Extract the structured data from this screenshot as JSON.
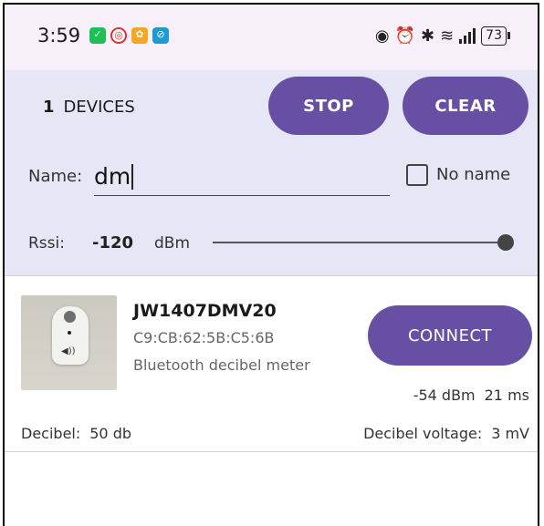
{
  "status_bar": {
    "time": "3:59",
    "notification_icons": [
      "wechat-icon",
      "app-icon",
      "meituan-icon",
      "link-icon"
    ],
    "battery": "73"
  },
  "panel": {
    "device_count": "1",
    "device_count_label": "DEVICES",
    "stop_label": "STOP",
    "clear_label": "CLEAR",
    "name_label": "Name:",
    "name_value": "dm",
    "no_name_label": "No name",
    "no_name_checked": false,
    "rssi_label": "Rssi:",
    "rssi_value": "-120",
    "rssi_unit": "dBm",
    "rssi_slider_fraction": 1.0
  },
  "devices": [
    {
      "name": "JW1407DMV20",
      "mac": "C9:CB:62:5B:C5:6B",
      "description": "Bluetooth decibel meter",
      "connect_label": "CONNECT",
      "rssi": "-54 dBm",
      "interval": "21 ms",
      "decibel_label": "Decibel:",
      "decibel_value": "50 db",
      "voltage_label": "Decibel voltage:",
      "voltage_value": "3 mV"
    }
  ],
  "colors": {
    "accent": "#6750a4",
    "panel_bg": "#e7e6f6",
    "status_bg": "#f8f0f8"
  }
}
